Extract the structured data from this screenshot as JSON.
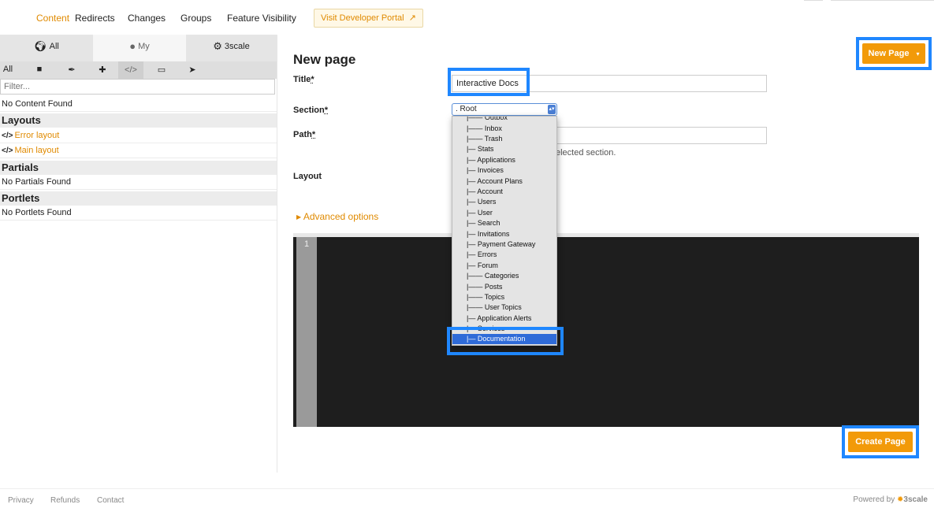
{
  "nav": {
    "items": [
      "Content",
      "Redirects",
      "Changes",
      "Groups",
      "Feature Visibility"
    ],
    "dev_portal": "Visit Developer Portal",
    "dev_portal_icon": "external-link-icon"
  },
  "sidebar": {
    "scopes": [
      {
        "label": "All",
        "icon": "globe-icon"
      },
      {
        "label": "My",
        "icon": "user-icon"
      },
      {
        "label": "3scale",
        "icon": "gear-icon"
      }
    ],
    "type_all": "All",
    "filter_placeholder": "Filter...",
    "no_content": "No Content Found",
    "layouts_heading": "Layouts",
    "layouts": [
      "Error layout",
      "Main layout"
    ],
    "partials_heading": "Partials",
    "no_partials": "No Partials Found",
    "portlets_heading": "Portlets",
    "no_portlets": "No Portlets Found"
  },
  "form": {
    "heading": "New page",
    "title_label": "Title",
    "title_value": "Interactive Docs",
    "section_label": "Section",
    "section_value": ". Root",
    "path_label": "Path",
    "path_hint": "elected section.",
    "layout_label": "Layout",
    "advanced": "Advanced options",
    "line_number": "1",
    "new_page_button": "New Page",
    "create_button": "Create Page",
    "required_mark": "*"
  },
  "section_options": [
    "|—— Outbox",
    "|—— Inbox",
    "|—— Trash",
    "|— Stats",
    "|— Applications",
    "|— Invoices",
    "|— Account Plans",
    "|— Account",
    "|— Users",
    "|— User",
    "|— Search",
    "|— Invitations",
    "|— Payment Gateway",
    "|— Errors",
    "|— Forum",
    "|—— Categories",
    "|—— Posts",
    "|—— Topics",
    "|—— User Topics",
    "|— Application Alerts",
    "|— Services",
    "|— Documentation"
  ],
  "footer": {
    "links": [
      "Privacy",
      "Refunds",
      "Contact"
    ],
    "powered": "Powered by",
    "brand": "3scale"
  },
  "colors": {
    "accent": "#f29a09",
    "highlight": "#1f87ff",
    "select": "#2f6bd8"
  }
}
